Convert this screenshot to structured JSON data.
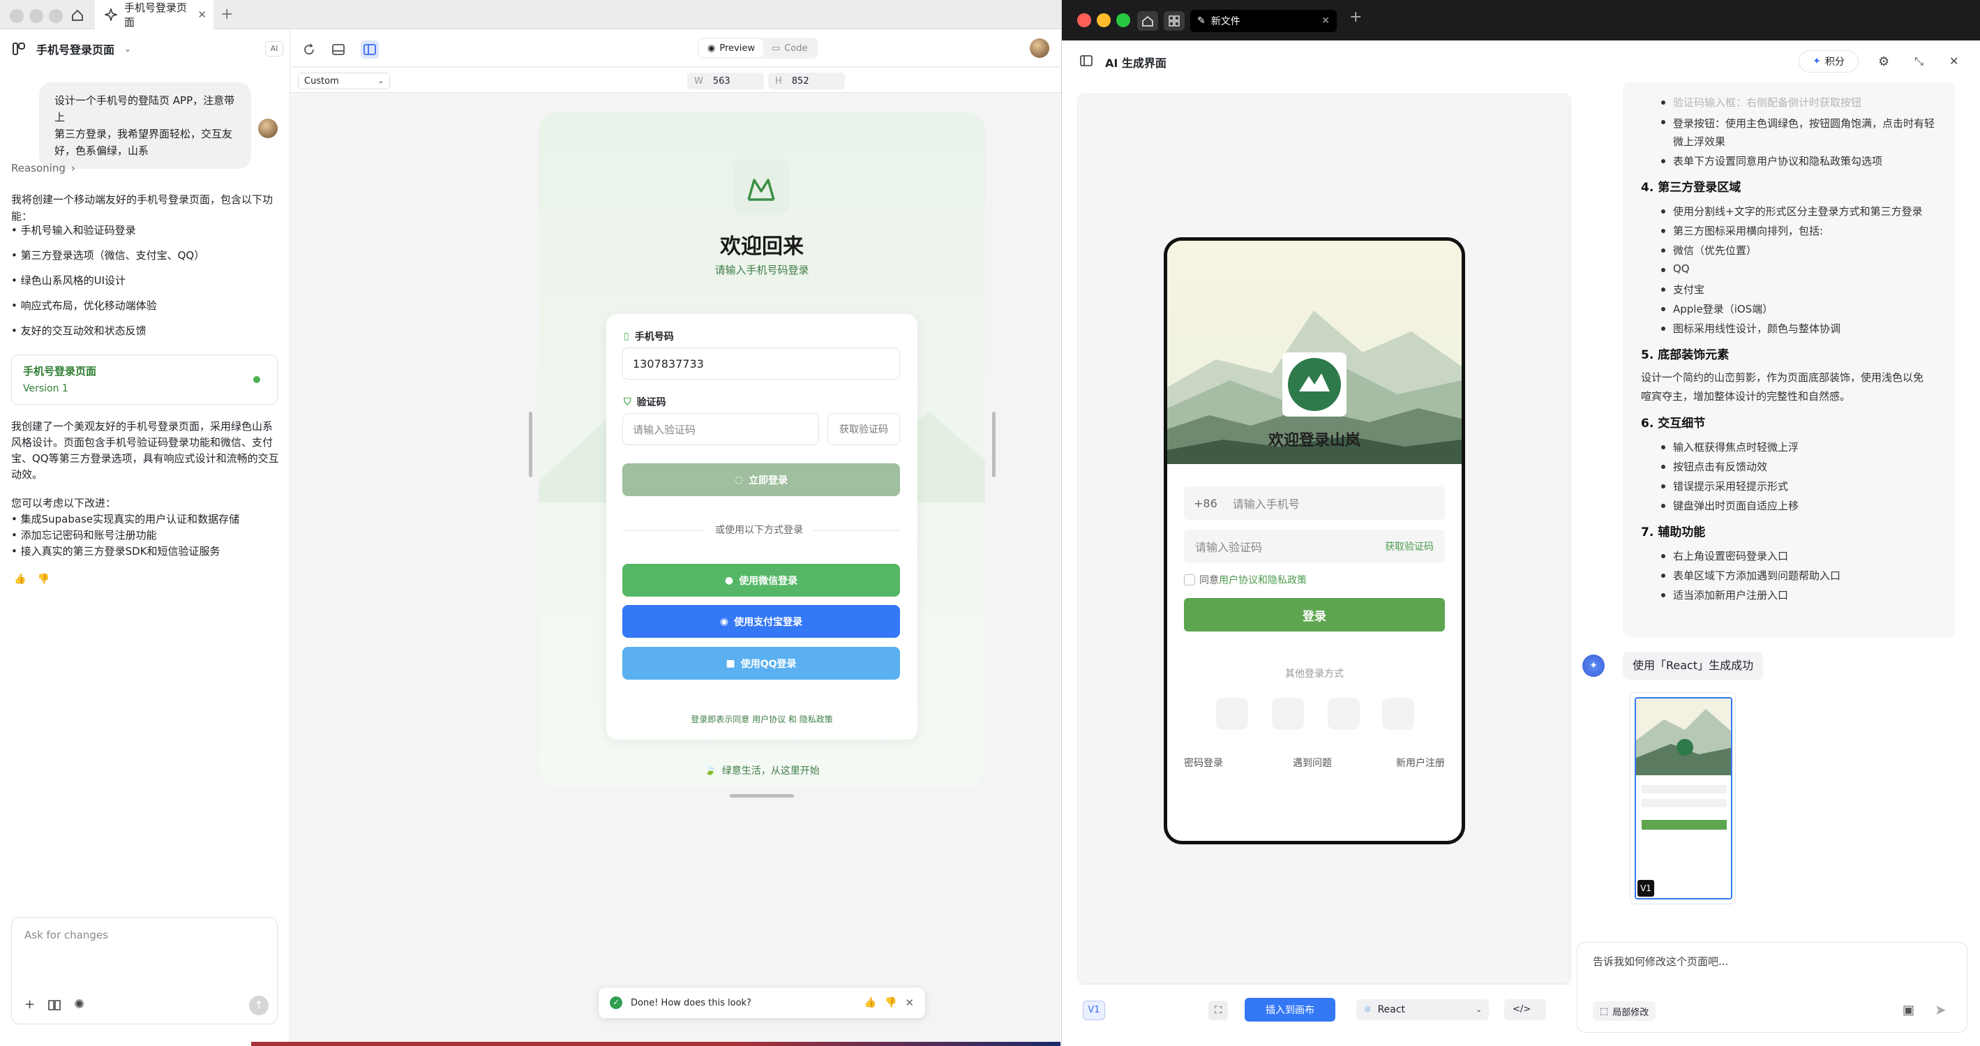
{
  "left": {
    "tab_title": "手机号登录页面",
    "project_title": "手机号登录页面",
    "ai_badge": "AI",
    "user_message": "设计一个手机号的登陆页 APP，注意带上第三方登录，我希望界面轻松，交互友好，色系偏绿，山系",
    "user_message_lines": [
      "设计一个手机号的登陆页 APP，注意带上",
      "第三方登录，我希望界面轻松，交互友",
      "好，色系偏绿，山系"
    ],
    "reasoning": "Reasoning",
    "intro_lines": [
      "我将创建一个移动端友好的手机号登录页面，包含以下功",
      "能："
    ],
    "features": [
      "手机号输入和验证码登录",
      "第三方登录选项（微信、支付宝、QQ）",
      "绿色山系风格的UI设计",
      "响应式布局，优化移动端体验",
      "友好的交互动效和状态反馈"
    ],
    "version_card": {
      "title": "手机号登录页面",
      "version": "Version 1"
    },
    "summary_lines": [
      "我创建了一个美观友好的手机号登录页面，采用绿色山系",
      "风格设计。页面包含手机号验证码登录功能和微信、支付",
      "宝、QQ等第三方登录选项，具有响应式设计和流畅的交互",
      "动效。"
    ],
    "improve_title": "您可以考虑以下改进：",
    "improvements": [
      "• 集成Supabase实现真实的用户认证和数据存储",
      "• 添加忘记密码和账号注册功能",
      "• 接入真实的第三方登录SDK和短信验证服务"
    ],
    "input_placeholder": "Ask for changes",
    "preview_tab": "Preview",
    "code_tab": "Code",
    "device": "Custom",
    "w_label": "W",
    "w_value": "563",
    "h_label": "H",
    "h_value": "852",
    "toast": "Done! How does this look?",
    "page": {
      "welcome": "欢迎回来",
      "sub": "请输入手机号码登录",
      "phone_label": "手机号码",
      "phone_value": "1307837733",
      "code_label": "验证码",
      "code_placeholder": "请输入验证码",
      "get_code": "获取验证码",
      "login_btn": "立即登录",
      "divider": "或使用以下方式登录",
      "wechat": "使用微信登录",
      "alipay": "使用支付宝登录",
      "qq": "使用QQ登录",
      "terms_prefix": "登录即表示同意 ",
      "terms": "用户协议",
      "and": " 和 ",
      "privacy": "隐私政策",
      "footer": "绿意生活，从这里开始"
    }
  },
  "right": {
    "tab_title": "新文件",
    "title": "AI 生成界面",
    "points": "积分",
    "faded": "验证码输入框：右侧配备倒计时获取按钮",
    "login_btn_desc": [
      "登录按钮：使用主色调绿色，按钮圆角饱满，点击时有轻",
      "微上浮效果"
    ],
    "agreement_desc": "表单下方设置同意用户协议和隐私政策勾选项",
    "s4": "4. 第三方登录区域",
    "s4_items": [
      "使用分割线+文字的形式区分主登录方式和第三方登录",
      "第三方图标采用横向排列，包括:",
      "微信（优先位置）",
      "QQ",
      "支付宝",
      "Apple登录（iOS端）",
      "图标采用线性设计，颜色与整体协调"
    ],
    "s5": "5. 底部装饰元素",
    "s5_text": [
      "设计一个简约的山峦剪影，作为页面底部装饰，使用浅色以免",
      "喧宾夺主，增加整体设计的完整性和自然感。"
    ],
    "s6": "6. 交互细节",
    "s6_items": [
      "输入框获得焦点时轻微上浮",
      "按钮点击有反馈动效",
      "错误提示采用轻提示形式",
      "键盘弹出时页面自适应上移"
    ],
    "s7": "7. 辅助功能",
    "s7_items": [
      "右上角设置密码登录入口",
      "表单区域下方添加遇到问题帮助入口",
      "适当添加新用户注册入口"
    ],
    "gen_msg": "使用「React」生成成功",
    "thumb_badge": "V1",
    "input_placeholder": "告诉我如何修改这个页面吧...",
    "local_edit": "局部修改",
    "v1": "V1",
    "insert": "插入到画布",
    "framework": "React",
    "phone": {
      "title": "欢迎登录山岚",
      "cc": "+86",
      "phone_ph": "请输入手机号",
      "code_ph": "请输入验证码",
      "get_code": "获取验证码",
      "agree_prefix": "同意",
      "agree_link": "用户协议和隐私政策",
      "login": "登录",
      "other": "其他登录方式",
      "pwd": "密码登录",
      "problem": "遇到问题",
      "register": "新用户注册"
    }
  },
  "colors": {
    "green": "#5aa85a",
    "blue": "#3478f6",
    "lightblue": "#5ab0f0",
    "muted_green": "#9fbf9f",
    "wechat": "#55b766"
  }
}
